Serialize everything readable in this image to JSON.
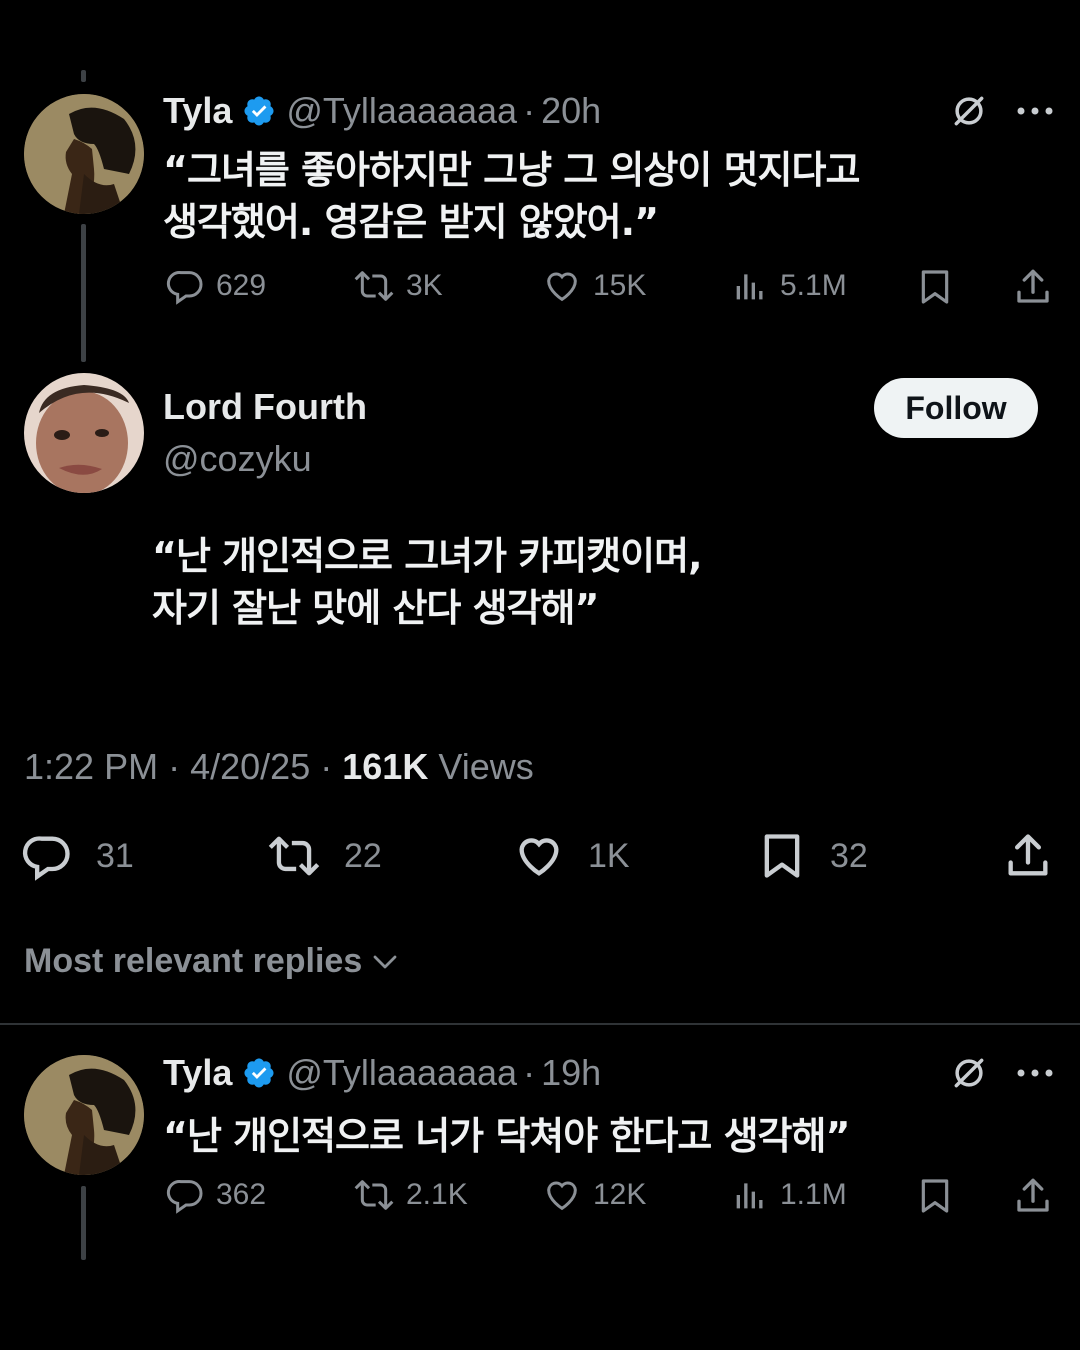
{
  "reply1": {
    "name": "Tyla",
    "handle": "@Tyllaaaaaaa",
    "sep": "·",
    "time": "20h",
    "text_line1": "“그녀를 좋아하지만 그냥 그 의상이 멋지다고",
    "text_line2": "생각했어. 영감은 받지 않았어.”",
    "replies": "629",
    "reposts": "3K",
    "likes": "15K",
    "views": "5.1M"
  },
  "main": {
    "name": "Lord Fourth",
    "handle": "@cozyku",
    "follow_label": "Follow",
    "text_line1": "“난 개인적으로 그녀가 카피캣이며,",
    "text_line2": "자기 잘난 맛에 산다 생각해”",
    "time": "1:22 PM",
    "date": "4/20/25",
    "sep": "·",
    "views_count": "161K",
    "views_label": "Views",
    "replies": "31",
    "reposts": "22",
    "likes": "1K",
    "bookmarks": "32"
  },
  "sort": {
    "label": "Most relevant replies"
  },
  "reply2": {
    "name": "Tyla",
    "handle": "@Tyllaaaaaaa",
    "sep": "·",
    "time": "19h",
    "text_line1": "“난 개인적으로 너가 닥쳐야 한다고 생각해”",
    "replies": "362",
    "reposts": "2.1K",
    "likes": "12K",
    "views": "1.1M"
  },
  "colors": {
    "background": "#000000",
    "text": "#e7e9ea",
    "muted": "#8b9096",
    "verified": "#1d9bf0",
    "follow_bg": "#eff3f4"
  }
}
